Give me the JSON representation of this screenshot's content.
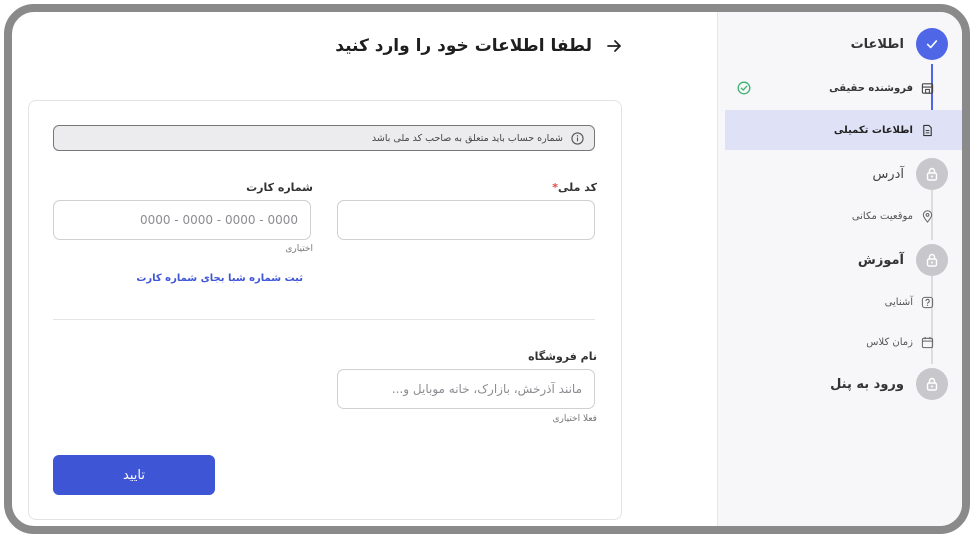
{
  "header": {
    "title": "لطفا اطلاعات خود را وارد کنید"
  },
  "notice": {
    "text": "شماره حساب باید متعلق به صاحب کد ملی باشد"
  },
  "form": {
    "national_code_label": "کد ملی",
    "required_mark": "*",
    "card_number_label": "شماره کارت",
    "card_number_placeholder": "0000 - 0000 - 0000 - 0000",
    "card_number_hint": "اختیاری",
    "sheba_link": "ثبت شماره شبا بجای شماره کارت",
    "store_name_label": "نام فروشگاه",
    "store_name_placeholder": "مانند آذرخش، بازارک، خانه موبایل و...",
    "store_name_hint": "فعلا اختیاری",
    "submit_label": "تایید"
  },
  "sidebar": {
    "steps": [
      {
        "label": "اطلاعات",
        "status": "done",
        "icon": "check-icon"
      },
      {
        "label": "آدرس",
        "status": "locked",
        "icon": "lock-icon"
      },
      {
        "label": "آموزش",
        "status": "locked",
        "icon": "lock-icon"
      },
      {
        "label": "ورود به پنل",
        "status": "locked",
        "icon": "lock-icon"
      }
    ],
    "substeps": {
      "info": [
        {
          "label": "فروشنده حقیقی",
          "icon": "store-icon",
          "completed": true
        },
        {
          "label": "اطلاعات تکمیلی",
          "icon": "document-icon",
          "selected": true
        }
      ],
      "address": [
        {
          "label": "موقعیت مکانی",
          "icon": "location-pin-icon"
        }
      ],
      "training": [
        {
          "label": "آشنایی",
          "icon": "question-icon"
        },
        {
          "label": "زمان کلاس",
          "icon": "calendar-icon"
        }
      ]
    }
  },
  "colors": {
    "accent": "#3e55d6",
    "step_active": "#4f67e6",
    "step_locked": "#c8c8cc",
    "selected_bg": "#dfe2f7",
    "success": "#3cb371",
    "required": "#e54848"
  }
}
